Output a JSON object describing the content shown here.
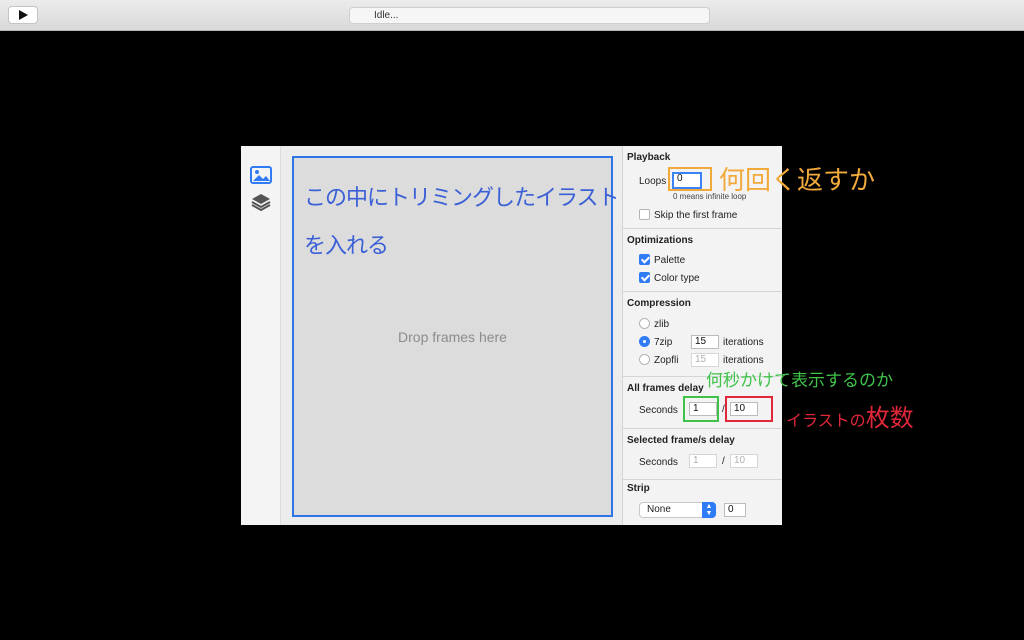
{
  "toolbar": {
    "play_icon": "play-icon",
    "status": "Idle..."
  },
  "sidebar": {
    "icons": [
      "image-icon",
      "layers-icon"
    ]
  },
  "drop_zone": {
    "placeholder": "Drop frames here",
    "annotation_line1": "この中にトリミングしたイラスト",
    "annotation_line2": "を入れる"
  },
  "playback": {
    "title": "Playback",
    "loops_label": "Loops",
    "loops_value": "0",
    "loops_hint": "0 means infinite loop",
    "skip_first_label": "Skip the first frame",
    "skip_first_checked": false
  },
  "optimizations": {
    "title": "Optimizations",
    "palette_label": "Palette",
    "palette_checked": true,
    "color_type_label": "Color type",
    "color_type_checked": true
  },
  "compression": {
    "title": "Compression",
    "zlib_label": "zlib",
    "sevenzip_label": "7zip",
    "sevenzip_iterations": "15",
    "zopfli_label": "Zopfli",
    "zopfli_iterations": "15",
    "iterations_label": "iterations",
    "selected": "7zip"
  },
  "all_frames_delay": {
    "title": "All frames delay",
    "seconds_label": "Seconds",
    "numerator": "1",
    "separator": "/",
    "denominator": "10"
  },
  "selected_frames_delay": {
    "title": "Selected frame/s delay",
    "seconds_label": "Seconds",
    "numerator": "1",
    "separator": "/",
    "denominator": "10"
  },
  "strip": {
    "title": "Strip",
    "selected_option": "None",
    "value": "0"
  },
  "annotations": {
    "loops_note": "何回く返すか",
    "seconds_note": "何秒かけて表示するのか",
    "frames_note_prefix": "イラストの",
    "frames_note_suffix": "枚数",
    "colors": {
      "orange": "#f2a93b",
      "green": "#3fc24a",
      "red": "#e0273a",
      "blue": "#3a5fd6"
    }
  }
}
